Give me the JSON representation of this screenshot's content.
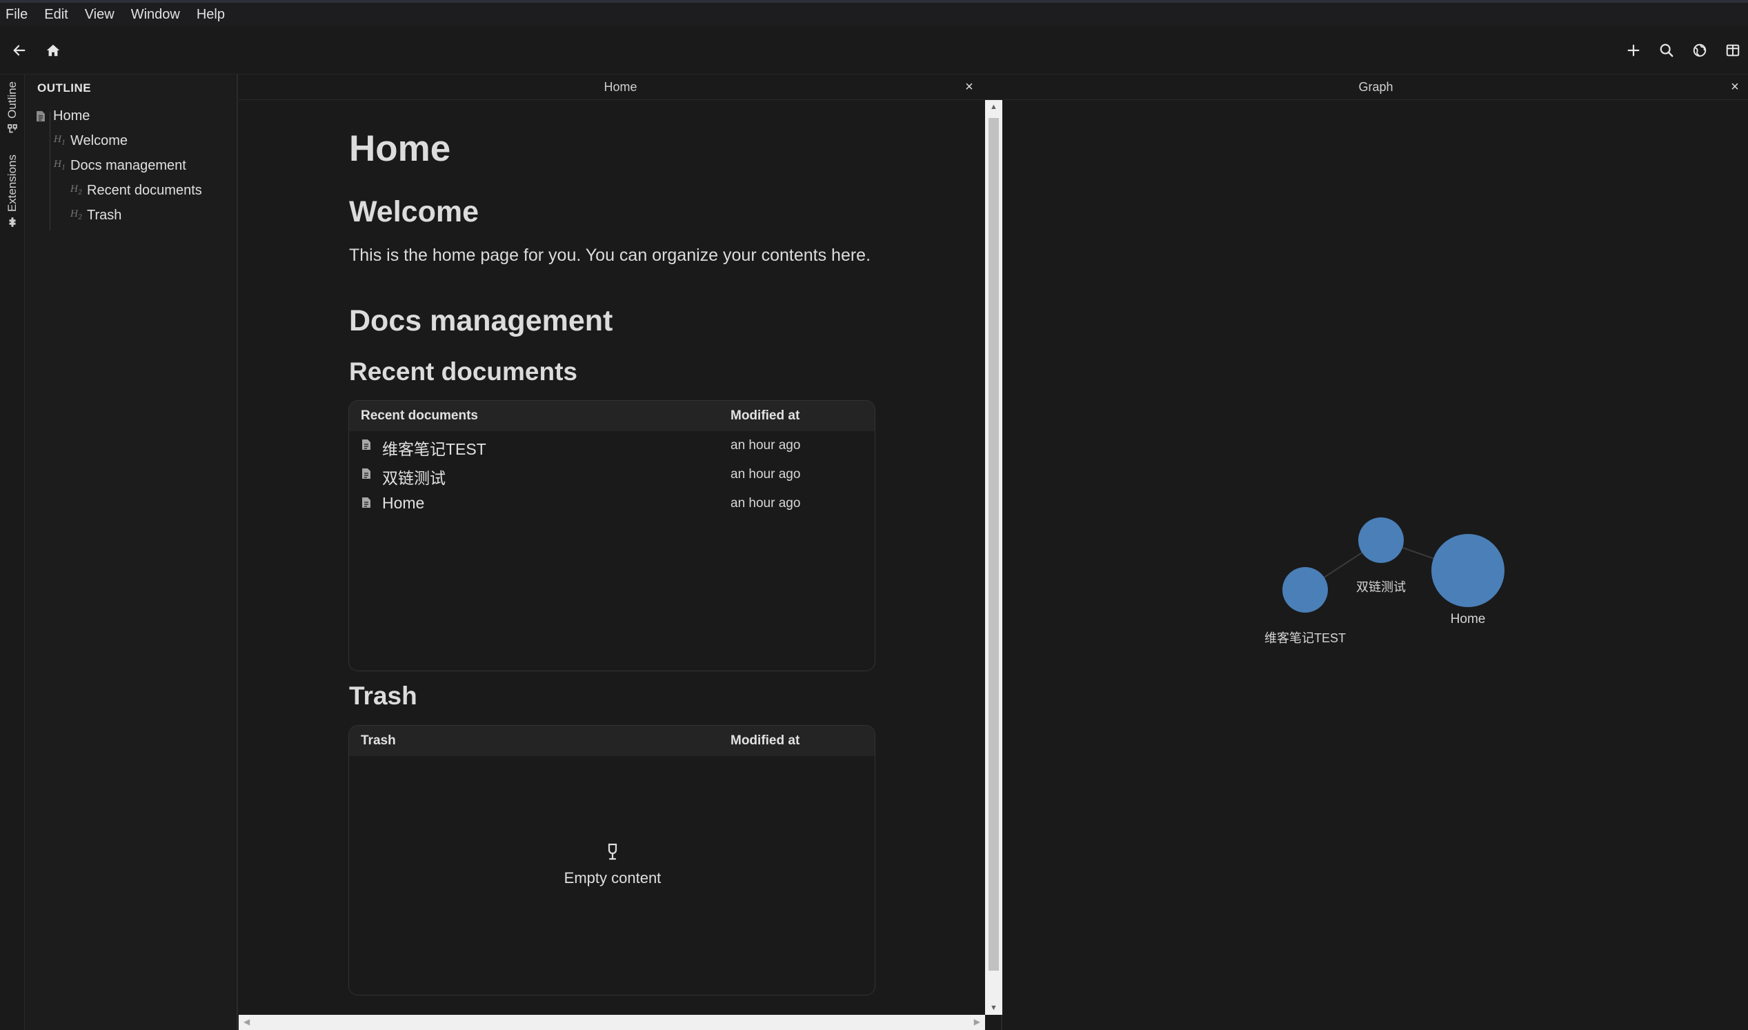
{
  "menu": [
    "File",
    "Edit",
    "View",
    "Window",
    "Help"
  ],
  "toolbar": {
    "left_icons": [
      "back-arrow-icon",
      "home-icon"
    ],
    "right_icons": [
      "plus-icon",
      "search-icon",
      "globe-icon",
      "split-layout-icon"
    ]
  },
  "activity": {
    "outline_label": "Outline",
    "extensions_label": "Extensions"
  },
  "outline": {
    "title": "OUTLINE",
    "items": [
      {
        "label": "Home",
        "level": "doc"
      },
      {
        "label": "Welcome",
        "level": "H1"
      },
      {
        "label": "Docs management",
        "level": "H1"
      },
      {
        "label": "Recent documents",
        "level": "H2"
      },
      {
        "label": "Trash",
        "level": "H2"
      }
    ]
  },
  "editor": {
    "tab_title": "Home",
    "close": "×",
    "heading": "Home",
    "welcome_heading": "Welcome",
    "welcome_text": "This is the home page for you. You can organize your contents here.",
    "docs_heading": "Docs management",
    "recent_heading": "Recent documents",
    "recent_table": {
      "col_name": "Recent documents",
      "col_time": "Modified at",
      "rows": [
        {
          "name": "维客笔记TEST",
          "time": "an hour ago"
        },
        {
          "name": "双链测试",
          "time": "an hour ago"
        },
        {
          "name": "Home",
          "time": "an hour ago"
        }
      ]
    },
    "trash_heading": "Trash",
    "trash_table": {
      "col_name": "Trash",
      "col_time": "Modified at",
      "empty_text": "Empty content"
    }
  },
  "graph": {
    "tab_title": "Graph",
    "close": "×",
    "node_color": "#4a7fb8",
    "nodes": [
      {
        "label": "维客笔记TEST"
      },
      {
        "label": "双链测试"
      },
      {
        "label": "Home"
      }
    ]
  }
}
